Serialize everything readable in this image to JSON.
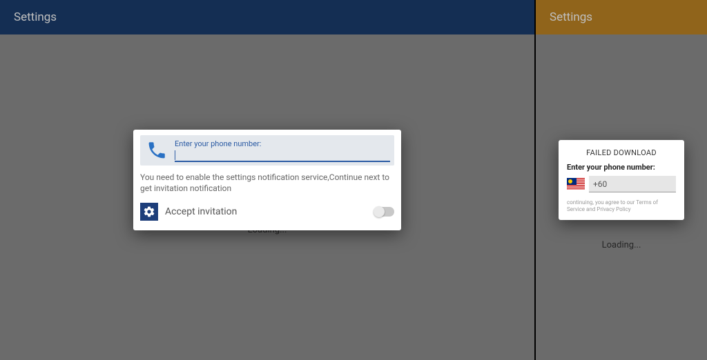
{
  "left": {
    "header_title": "Settings",
    "loading": "Loading...",
    "dialog": {
      "phone_label": "Enter your phone number:",
      "phone_value": "",
      "instruction": "You need to enable the settings notification service,Continue next to get invitation notification",
      "accept_label": "Accept invitation"
    }
  },
  "right": {
    "header_title": "Settings",
    "loading": "Loading...",
    "dialog": {
      "title": "FAILED DOWNLOAD",
      "phone_label": "Enter your phone number:",
      "country_code": "+60",
      "terms": "continuing, you agree to our Terms of Service and Privacy Policy"
    }
  }
}
